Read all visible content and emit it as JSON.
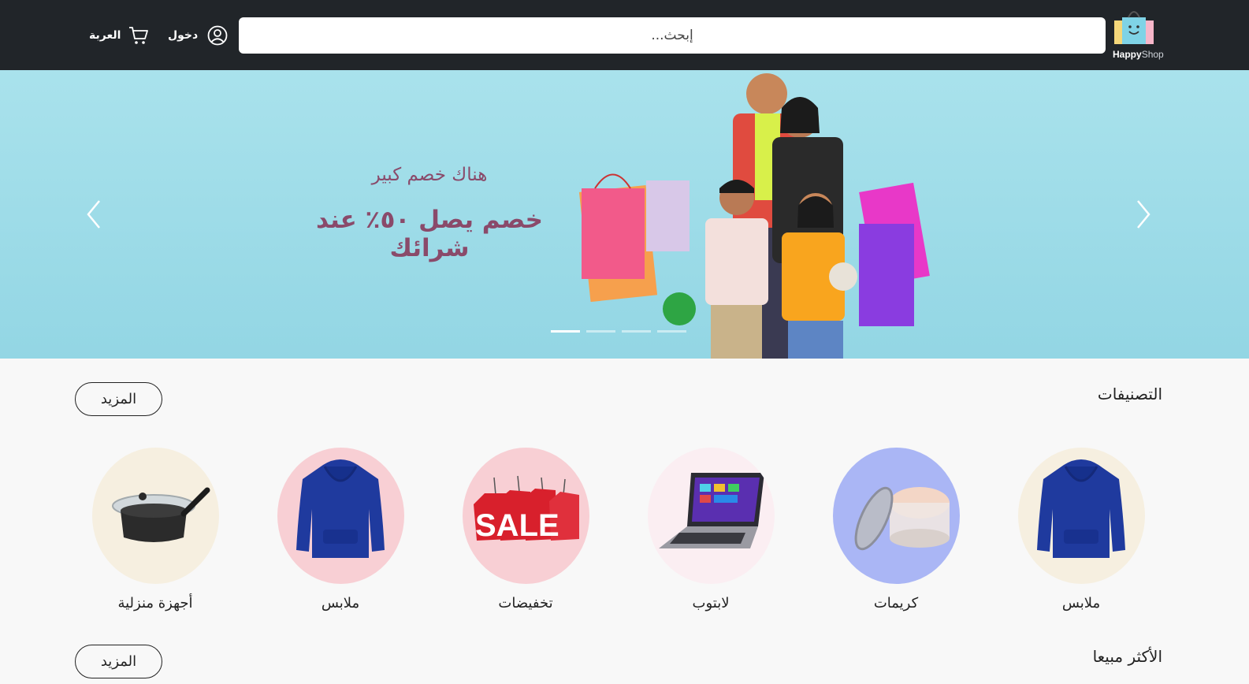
{
  "header": {
    "logo_text_main": "Happy",
    "logo_text_sub": "Shop",
    "search_placeholder": "إبحث...",
    "login_label": "دخول",
    "cart_label": "العربة"
  },
  "hero": {
    "subtitle": "هناك خصم كبير",
    "title": "خصم يصل ٥٠٪ عند شرائك",
    "slide_count": 4,
    "active_slide": 1
  },
  "categories_section": {
    "title": "التصنيفات",
    "more_label": "المزيد",
    "items": [
      {
        "label": "ملابس",
        "icon": "hoodie-icon",
        "bg": "#f6efe0"
      },
      {
        "label": "كريمات",
        "icon": "cream-jar-icon",
        "bg": "#aab6f5"
      },
      {
        "label": "لابتوب",
        "icon": "laptop-icon",
        "bg": "#fbeef2"
      },
      {
        "label": "تخفيضات",
        "icon": "sale-tags-icon",
        "bg": "#f8cfd4"
      },
      {
        "label": "ملابس",
        "icon": "hoodie-icon",
        "bg": "#f8cfd4"
      },
      {
        "label": "أجهزة منزلية",
        "icon": "saucepan-icon",
        "bg": "#f6efe0"
      }
    ]
  },
  "bestsellers_section": {
    "title": "الأكثر مبيعا",
    "more_label": "المزيد"
  },
  "colors": {
    "header_bg": "#212529",
    "hero_text": "#8a4a6a",
    "hoodie_blue": "#1f3a9e",
    "sale_red": "#d8202c"
  }
}
